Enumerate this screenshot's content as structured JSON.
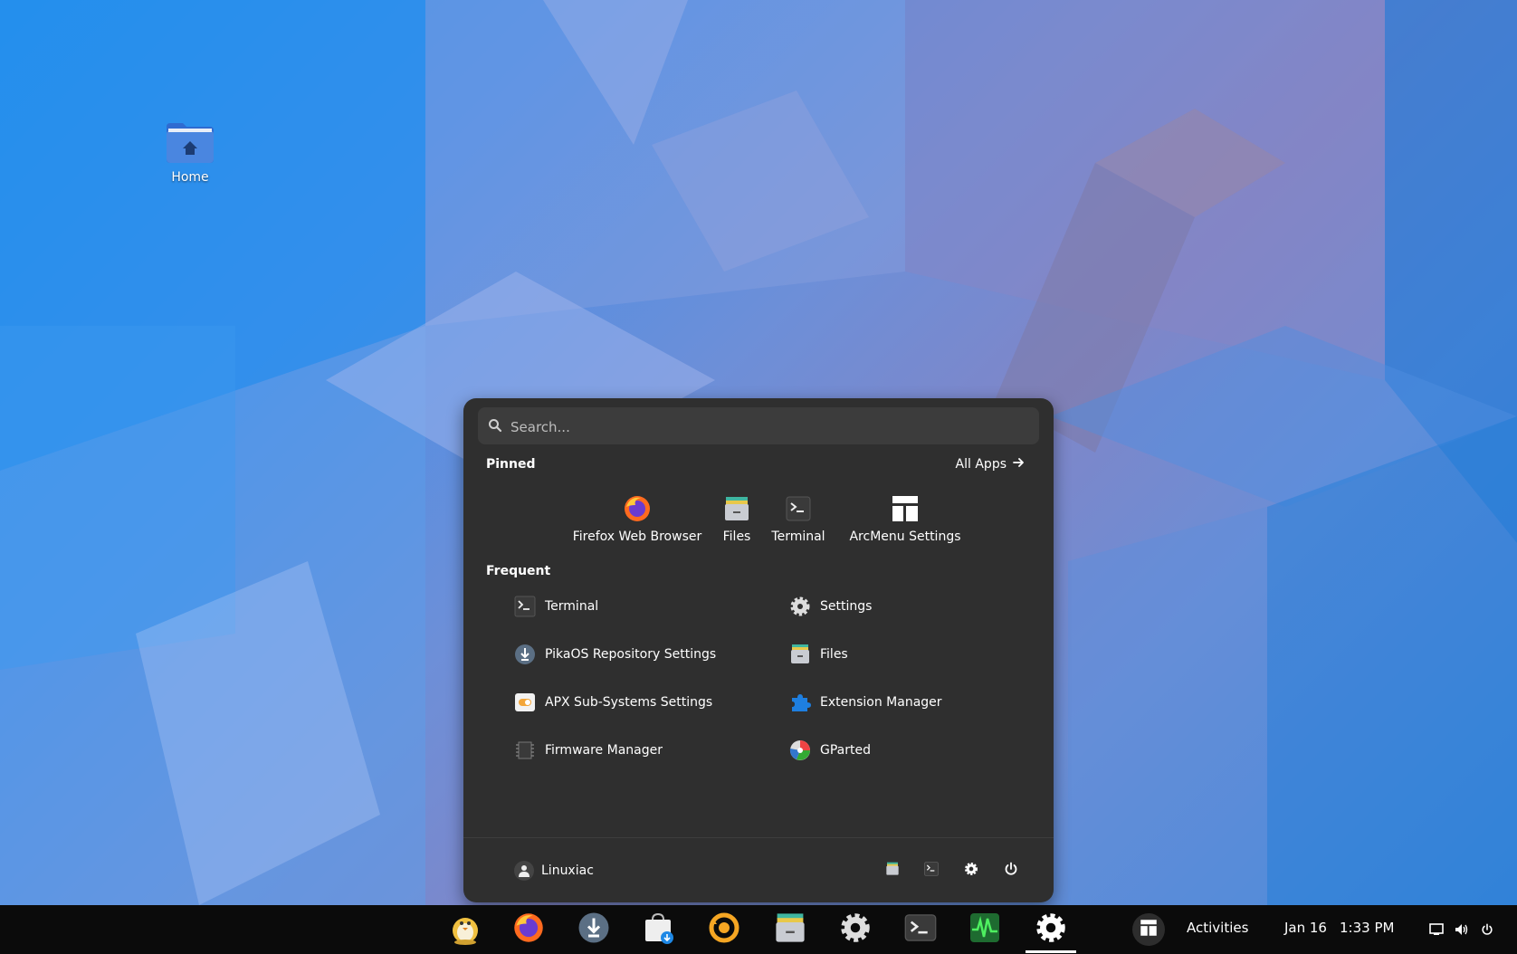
{
  "desktop": {
    "home_label": "Home"
  },
  "menu": {
    "search_placeholder": "Search...",
    "pinned_title": "Pinned",
    "all_apps_label": "All Apps",
    "pinned": [
      {
        "label": "Firefox Web Browser",
        "icon": "firefox-icon"
      },
      {
        "label": "Files",
        "icon": "files-icon"
      },
      {
        "label": "Terminal",
        "icon": "terminal-icon"
      },
      {
        "label": "ArcMenu Settings",
        "icon": "arcmenu-icon"
      }
    ],
    "frequent_title": "Frequent",
    "frequent": [
      {
        "label": "Terminal",
        "icon": "terminal-icon"
      },
      {
        "label": "Settings",
        "icon": "gear-icon"
      },
      {
        "label": "PikaOS Repository Settings",
        "icon": "download-icon"
      },
      {
        "label": "Files",
        "icon": "files-icon"
      },
      {
        "label": "APX Sub-Systems Settings",
        "icon": "toggle-icon"
      },
      {
        "label": "Extension Manager",
        "icon": "puzzle-icon"
      },
      {
        "label": "Firmware Manager",
        "icon": "chip-icon"
      },
      {
        "label": "GParted",
        "icon": "gparted-icon"
      }
    ],
    "user_name": "Linuxiac"
  },
  "taskbar": {
    "activities_label": "Activities",
    "date": "Jan 16",
    "time": "1:33 PM"
  },
  "colors": {
    "menu_bg": "#2f2f2f",
    "search_bg": "#3c3c3c",
    "taskbar_bg": "#0b0b0b",
    "accent": "#3a86d8"
  }
}
